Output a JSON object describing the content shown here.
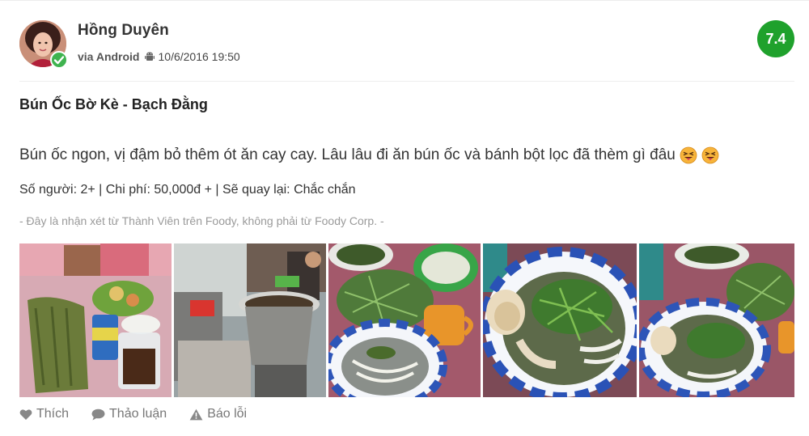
{
  "review": {
    "user_name": "Hồng Duyên",
    "via": "via Android",
    "datetime": "10/6/2016 19:50",
    "score": "7.4",
    "title": "Bún Ốc Bờ Kè - Bạch Đằng",
    "body": "Bún ốc ngon, vị đậm bỏ thêm ót ăn cay cay. Lâu lâu đi ăn bún ốc và bánh bột lọc đã thèm gì đâu",
    "stats": "Số người: 2+ | Chi phí: 50,000đ + | Sẽ quay lại: Chắc chắn",
    "disclaimer": "- Đây là nhận xét từ Thành Viên trên Foody, không phải từ Foody Corp. -"
  },
  "actions": {
    "like_label": "Thích",
    "discuss_label": "Thảo luận",
    "report_label": "Báo lỗi"
  },
  "icons": {
    "verified": "check-badge-icon",
    "platform": "android-icon",
    "like": "heart-icon",
    "discuss": "comment-icon",
    "report": "warning-icon",
    "emoji": "squinting-tongue-emoji-icon"
  },
  "colors": {
    "score_badge": "#1fa12c",
    "verified_badge": "#3fb34f",
    "disclaimer": "#9a9a9a"
  }
}
